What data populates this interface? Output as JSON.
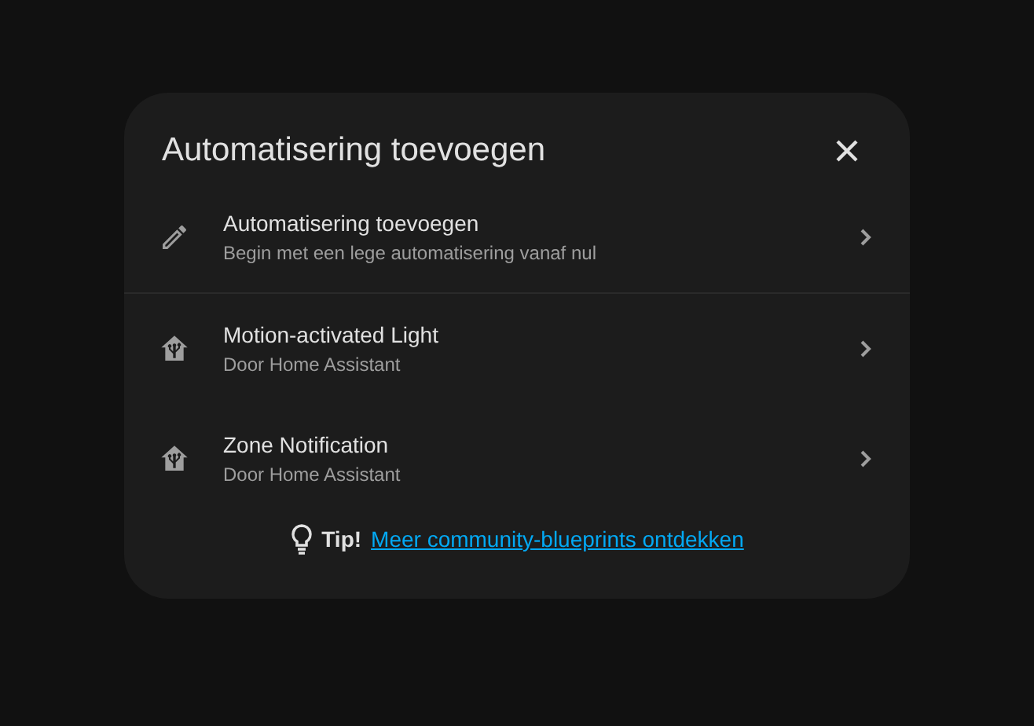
{
  "dialog": {
    "title": "Automatisering toevoegen",
    "items": [
      {
        "kind": "new",
        "title": "Automatisering toevoegen",
        "subtitle": "Begin met een lege automatisering vanaf nul"
      },
      {
        "kind": "blueprint",
        "title": "Motion-activated Light",
        "subtitle": "Door Home Assistant"
      },
      {
        "kind": "blueprint",
        "title": "Zone Notification",
        "subtitle": "Door Home Assistant"
      }
    ],
    "tip": {
      "label": "Tip!",
      "link": "Meer community-blueprints ontdekken"
    }
  }
}
